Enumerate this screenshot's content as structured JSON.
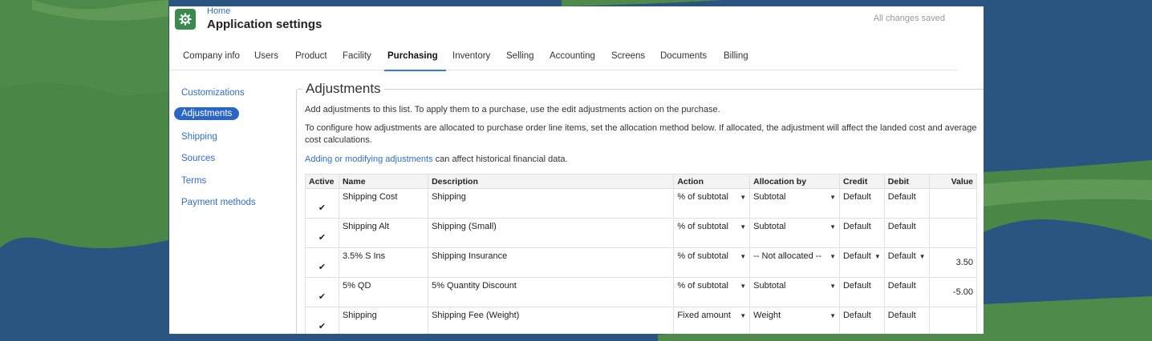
{
  "header": {
    "home_link": "Home",
    "title": "Application settings",
    "save_status": "All changes saved"
  },
  "tabs": [
    {
      "label": "Company info"
    },
    {
      "label": "Users"
    },
    {
      "label": "Product"
    },
    {
      "label": "Facility"
    },
    {
      "label": "Purchasing",
      "active": true
    },
    {
      "label": "Inventory"
    },
    {
      "label": "Selling"
    },
    {
      "label": "Accounting"
    },
    {
      "label": "Screens"
    },
    {
      "label": "Documents"
    },
    {
      "label": "Billing"
    }
  ],
  "sidebar": {
    "items": [
      {
        "label": "Customizations"
      },
      {
        "label": "Adjustments",
        "active": true
      },
      {
        "label": "Shipping"
      },
      {
        "label": "Sources"
      },
      {
        "label": "Terms"
      },
      {
        "label": "Payment methods"
      }
    ]
  },
  "main": {
    "legend": "Adjustments",
    "para1": "Add adjustments to this list. To apply them to a purchase, use the edit adjustments action on the purchase.",
    "para2": "To configure how adjustments are allocated to purchase order line items, set the allocation method below. If allocated, the adjustment will affect the landed cost and average cost calculations.",
    "para3_link": "Adding or modifying adjustments",
    "para3_rest": " can affect historical financial data.",
    "table": {
      "headers": [
        "Active",
        "Name",
        "Description",
        "Action",
        "Allocation by",
        "Credit",
        "Debit",
        "Value"
      ],
      "rows": [
        {
          "active": "✔",
          "name": "Shipping Cost",
          "description": "Shipping",
          "action": "% of subtotal",
          "allocation": "Subtotal",
          "credit": "Default",
          "debit": "Default",
          "value": ""
        },
        {
          "active": "✔",
          "name": "Shipping Alt",
          "description": "Shipping (Small)",
          "action": "% of subtotal",
          "allocation": "Subtotal",
          "credit": "Default",
          "debit": "Default",
          "value": ""
        },
        {
          "active": "✔",
          "name": "3.5% S Ins",
          "description": "Shipping Insurance",
          "action": "% of subtotal",
          "allocation": "-- Not allocated --",
          "credit": "Default",
          "debit": "Default",
          "value": "3.50"
        },
        {
          "active": "✔",
          "name": "5% QD",
          "description": "5% Quantity Discount",
          "action": "% of subtotal",
          "allocation": "Subtotal",
          "credit": "Default",
          "debit": "Default",
          "value": "-5.00"
        },
        {
          "active": "✔",
          "name": "Shipping",
          "description": "Shipping Fee (Weight)",
          "action": "Fixed amount",
          "allocation": "Weight",
          "credit": "Default",
          "debit": "Default",
          "value": ""
        }
      ]
    }
  },
  "colors": {
    "background_blue": "#2a5580",
    "background_green": "#4e8a4a",
    "accent": "#2c66c4",
    "app_icon": "#3a8a4e"
  }
}
